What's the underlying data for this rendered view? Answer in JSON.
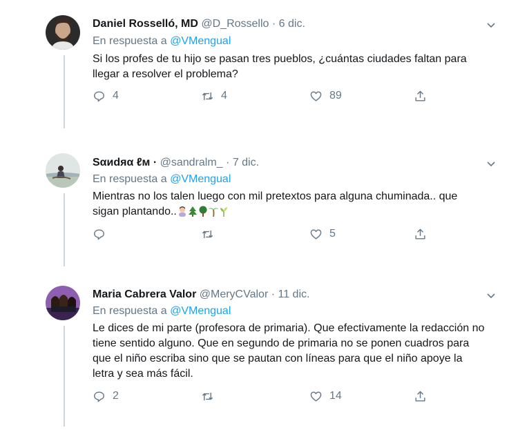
{
  "tweets": [
    {
      "name": "Daniel Rosselló, MD",
      "handle": "@D_Rossello",
      "dot": "·",
      "date": "6 dic.",
      "reply_prefix": "En respuesta a",
      "reply_mention": "@VMengual",
      "text": "Si los profes de tu hijo se pasan tres pueblos, ¿cuántas ciudades faltan para llegar a resolver el problema?",
      "replies": "4",
      "retweets": "4",
      "likes": "89"
    },
    {
      "name": "Ѕαиdяα ℓм",
      "handle": "@sandralm_",
      "dot": "·",
      "date": "7 dic.",
      "reply_prefix": "En respuesta a",
      "reply_mention": "@VMengual",
      "text": "Mientras no los talen luego con mil pretextos para alguna chuminada.. que sigan plantando..",
      "emojis": [
        "woman-emoji",
        "evergreen-tree-emoji",
        "deciduous-tree-emoji",
        "palm-tree-emoji",
        "seedling-emoji"
      ],
      "name_suffix": "·",
      "replies": "",
      "retweets": "",
      "likes": "5"
    },
    {
      "name": "Maria Cabrera Valor",
      "handle": "@MeryCValor",
      "dot": "·",
      "date": "11 dic.",
      "reply_prefix": "En respuesta a",
      "reply_mention": "@VMengual",
      "text": "Le dices de mi parte (profesora de primaria). Que efectivamente la redacción no tiene sentido alguno. Que en segundo de primaria no se ponen cuadros para que el niño escriba sino que se pautan con líneas para que el niño apoye la letra y sea más fácil.",
      "replies": "2",
      "retweets": "",
      "likes": "14"
    }
  ],
  "colors": {
    "muted": "#657786",
    "link": "#1da1f2",
    "line": "#ccd6dd"
  }
}
